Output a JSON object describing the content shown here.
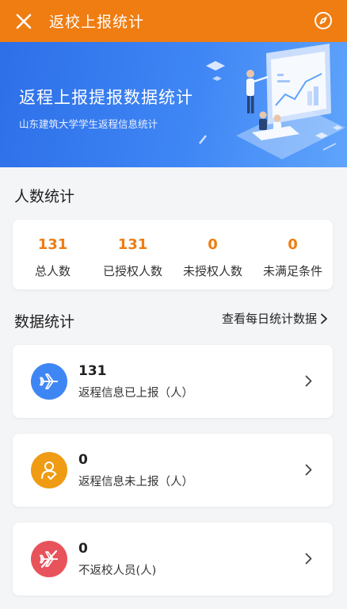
{
  "topbar": {
    "title": "返校上报统计",
    "close_icon": "close-icon",
    "compass_icon": "compass-icon",
    "color": "#ef7d12"
  },
  "banner": {
    "title": "返程上报提报数据统计",
    "subtitle": "山东建筑大学学生返程信息统计"
  },
  "people": {
    "section_title": "人数统计",
    "stats": [
      {
        "value": "131",
        "label": "总人数"
      },
      {
        "value": "131",
        "label": "已授权人数"
      },
      {
        "value": "0",
        "label": "未授权人数"
      },
      {
        "value": "0",
        "label": "未满足条件"
      }
    ]
  },
  "data_stats": {
    "section_title": "数据统计",
    "daily_link": "查看每日统计数据",
    "rows": [
      {
        "value": "131",
        "label": "返程信息已上报（人）",
        "icon": "airplane-icon",
        "color": "#3f86f5"
      },
      {
        "value": "0",
        "label": "返程信息未上报（人）",
        "icon": "person-refresh-icon",
        "color": "#ef9b14"
      },
      {
        "value": "0",
        "label": "不返校人员(人)",
        "icon": "no-airplane-icon",
        "color": "#e8535b"
      }
    ]
  }
}
